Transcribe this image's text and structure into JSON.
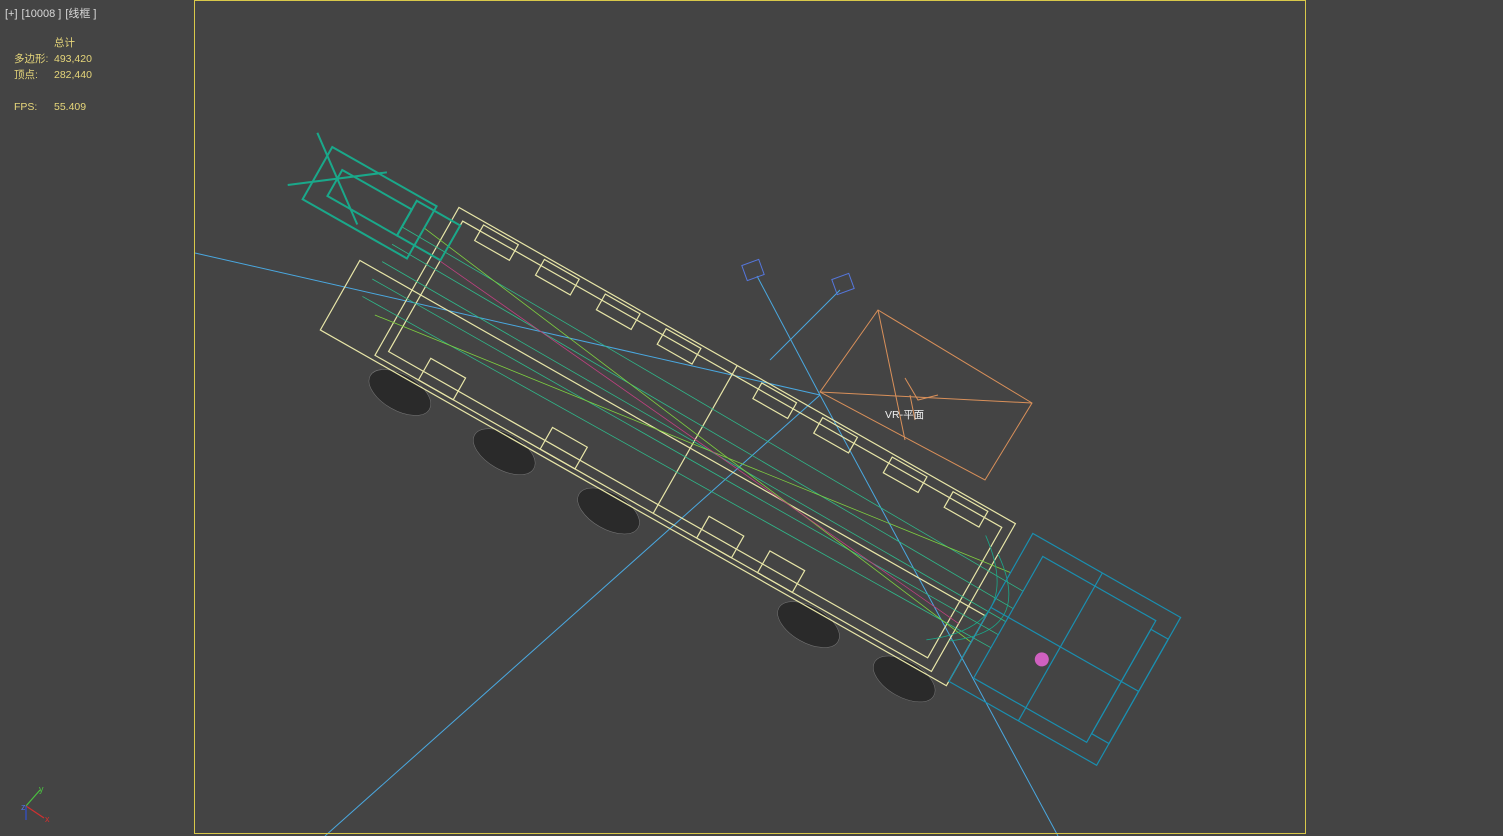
{
  "viewport": {
    "menu_plus": "[+]",
    "camera_name": "[10008 ]",
    "shading_mode": "[线框 ]"
  },
  "stats": {
    "header": "总计",
    "polygons_label": "多边形:",
    "polygons_value": "493,420",
    "vertices_label": "顶点:",
    "vertices_value": "282,440",
    "fps_label": "FPS:",
    "fps_value": "55.409"
  },
  "scene": {
    "object_label": "VR-平面"
  },
  "gizmo": {
    "x": "x",
    "y": "y",
    "z": "z"
  },
  "colors": {
    "background": "#444444",
    "frame": "#d9c84a",
    "stats_text": "#e6d67a",
    "body_wire": "#e8e6a8",
    "crane_wire": "#1aa88a",
    "cab_wire": "#1a8fb0",
    "camera_line": "#4aa8e0",
    "vr_plane": "#d9905a"
  }
}
